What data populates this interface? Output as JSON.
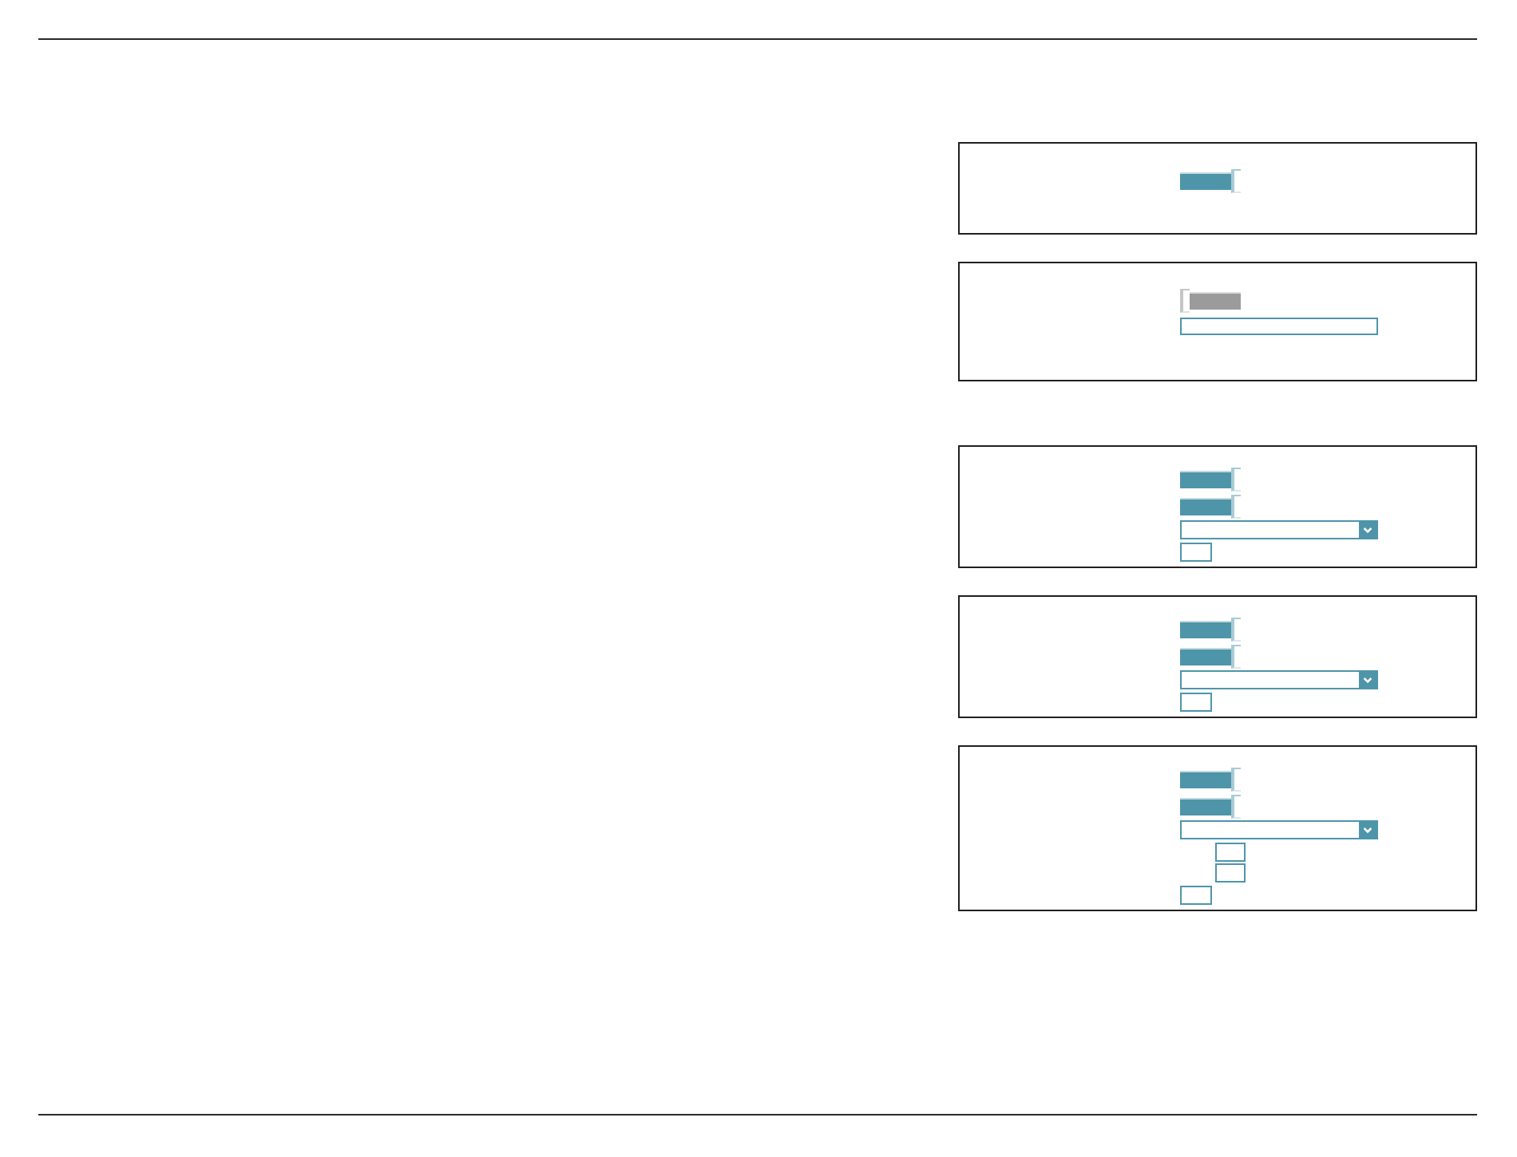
{
  "sections": [
    {
      "panels": [
        {
          "controls": [
            {
              "kind": "toggle",
              "on": true
            }
          ]
        },
        {
          "controls": [
            {
              "kind": "toggle",
              "on": false
            },
            {
              "kind": "text_field"
            }
          ]
        }
      ]
    },
    {
      "panels": [
        {
          "controls": [
            {
              "kind": "toggle",
              "on": true
            },
            {
              "kind": "toggle",
              "on": true
            },
            {
              "kind": "dropdown"
            },
            {
              "kind": "button"
            }
          ]
        },
        {
          "controls": [
            {
              "kind": "toggle",
              "on": true
            },
            {
              "kind": "toggle",
              "on": true
            },
            {
              "kind": "dropdown"
            },
            {
              "kind": "button"
            }
          ]
        },
        {
          "controls": [
            {
              "kind": "toggle",
              "on": true
            },
            {
              "kind": "toggle",
              "on": true
            },
            {
              "kind": "dropdown"
            },
            {
              "kind": "small_field"
            },
            {
              "kind": "small_field"
            },
            {
              "kind": "button"
            }
          ]
        }
      ]
    }
  ]
}
